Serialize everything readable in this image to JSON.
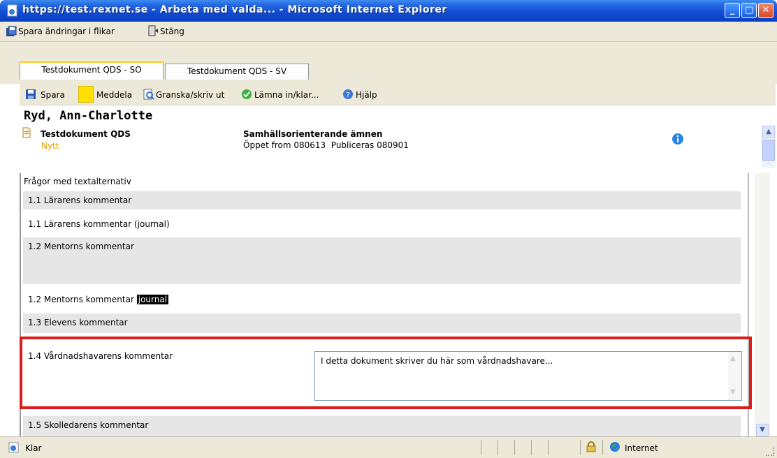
{
  "window": {
    "title": "https://test.rexnet.se - Arbeta med valda... - Microsoft Internet Explorer",
    "buttons": {
      "minimize": "_",
      "maximize": "□",
      "close": "✕"
    }
  },
  "toolbar_top": {
    "save_tabs": "Spara ändringar i flikar",
    "close": "Stäng"
  },
  "tabs": [
    {
      "label": "Testdokument QDS - SO",
      "active": true
    },
    {
      "label": "Testdokument QDS - SV",
      "active": false
    }
  ],
  "toolbar_doc": {
    "save": "Spara",
    "notify": "Meddela",
    "review_print": "Granska/skriv ut",
    "submit": "Lämna in/klar...",
    "help": "Hjälp"
  },
  "header": {
    "student_name": "Ryd, Ann-Charlotte",
    "document_name": "Testdokument QDS",
    "document_status": "Nytt",
    "subject": "Samhällsorienterande ämnen",
    "open_from_label": "Öppet from",
    "open_from": "080613",
    "publish_label": "Publiceras",
    "publish": "080901"
  },
  "form": {
    "section_title": "Frågor med textalternativ",
    "rows": [
      {
        "label": "1.1 Lärarens kommentar"
      },
      {
        "label": "1.1 Lärarens kommentar (journal)"
      },
      {
        "label": "1.2 Mentorns kommentar"
      },
      {
        "label": "1.2 Mentorns kommentar",
        "highlight": "journal"
      },
      {
        "label": "1.3 Elevens kommentar"
      },
      {
        "label": "1.4 Vårdnadshavarens kommentar"
      },
      {
        "label": "1.5 Skolledarens kommentar"
      }
    ],
    "guardian_comment": "I detta dokument skriver du här som vårdnadshavare..."
  },
  "statusbar": {
    "status": "Klar",
    "zone": "Internet"
  },
  "colors": {
    "highlight_border": "#e01b1b",
    "title_bar": "#0a3fc0",
    "chrome": "#ece9d8"
  }
}
